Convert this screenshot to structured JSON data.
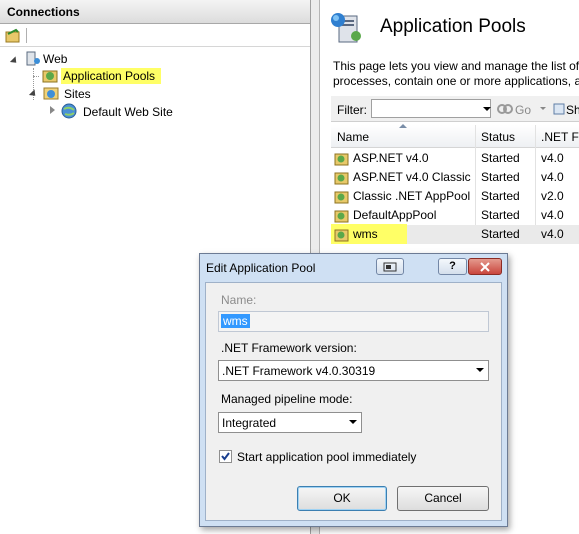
{
  "connections": {
    "title": "Connections",
    "tree": {
      "web": "Web",
      "app_pools": "Application Pools",
      "sites": "Sites",
      "default_site": "Default Web Site"
    }
  },
  "main": {
    "title": "Application Pools",
    "description_line1": "This page lets you view and manage the list of",
    "description_line2": "processes, contain one or more applications, a",
    "filter_label": "Filter:",
    "go_label": "Go",
    "show_label": "Sh",
    "columns": [
      "Name",
      "Status",
      ".NET Fr"
    ],
    "pools": [
      {
        "name": "ASP.NET v4.0",
        "status": "Started",
        "net": "v4.0"
      },
      {
        "name": "ASP.NET v4.0 Classic",
        "status": "Started",
        "net": "v4.0"
      },
      {
        "name": "Classic .NET AppPool",
        "status": "Started",
        "net": "v2.0"
      },
      {
        "name": "DefaultAppPool",
        "status": "Started",
        "net": "v4.0"
      },
      {
        "name": "wms",
        "status": "Started",
        "net": "v4.0"
      }
    ]
  },
  "dialog": {
    "title": "Edit Application Pool",
    "help_glyph": "?",
    "name_label": "Name:",
    "name_value": "wms",
    "framework_label": ".NET Framework version:",
    "framework_value": ".NET Framework v4.0.30319",
    "pipeline_label": "Managed pipeline mode:",
    "pipeline_value": "Integrated",
    "start_label": "Start application pool immediately",
    "start_checked": true,
    "ok_label": "OK",
    "cancel_label": "Cancel"
  },
  "colors": {
    "highlight": "#ffff66",
    "dialog_frame": "#cfe0f3",
    "close_button": "#c9463d"
  }
}
